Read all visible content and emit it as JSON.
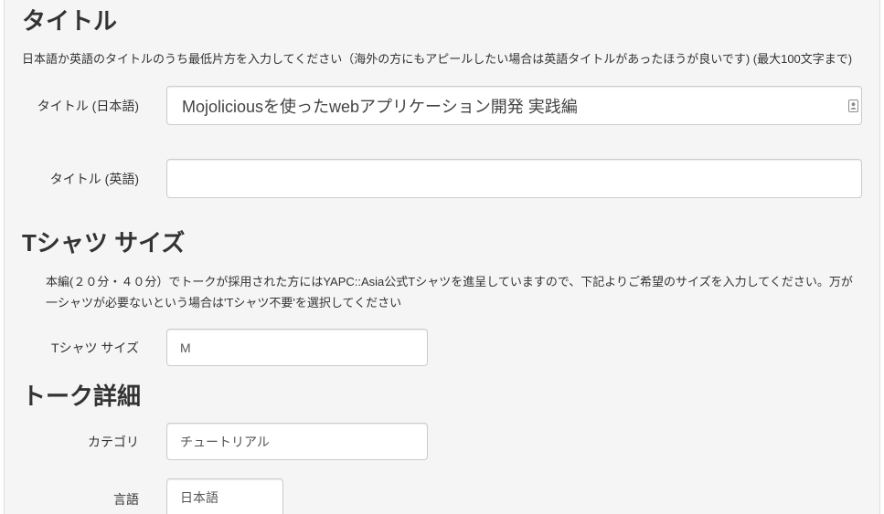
{
  "colors": {
    "panel_background": "#f5f5f5",
    "text": "#333333",
    "input_border": "#cccccc",
    "input_text": "#555555"
  },
  "title_section": {
    "heading": "タイトル",
    "description": "日本語か英語のタイトルのうち最低片方を入力してください（海外の方にもアピールしたい場合は英語タイトルがあったほうが良いです) (最大100文字まで)",
    "title_ja": {
      "label": "タイトル (日本語)",
      "value": "Mojoliciousを使ったwebアプリケーション開発 実践編",
      "icon": "contacts-autofill-icon"
    },
    "title_en": {
      "label": "タイトル (英語)",
      "value": ""
    }
  },
  "tshirt_section": {
    "heading": "Tシャツ サイズ",
    "description_lines": [
      "本編(２０分・４０分）でトークが採用された方にはYAPC::Asia公式Tシャツを進呈していますので、下記よりご希望のサイズを入力してください。万が",
      "一シャツが必要ないという場合は'Tシャツ不要'を選択してください"
    ],
    "size": {
      "label": "Tシャツ サイズ",
      "value": "M"
    }
  },
  "talk_details_section": {
    "heading": "トーク詳細",
    "category": {
      "label": "カテゴリ",
      "value": "チュートリアル"
    },
    "language": {
      "label": "言語",
      "value": "日本語"
    }
  }
}
